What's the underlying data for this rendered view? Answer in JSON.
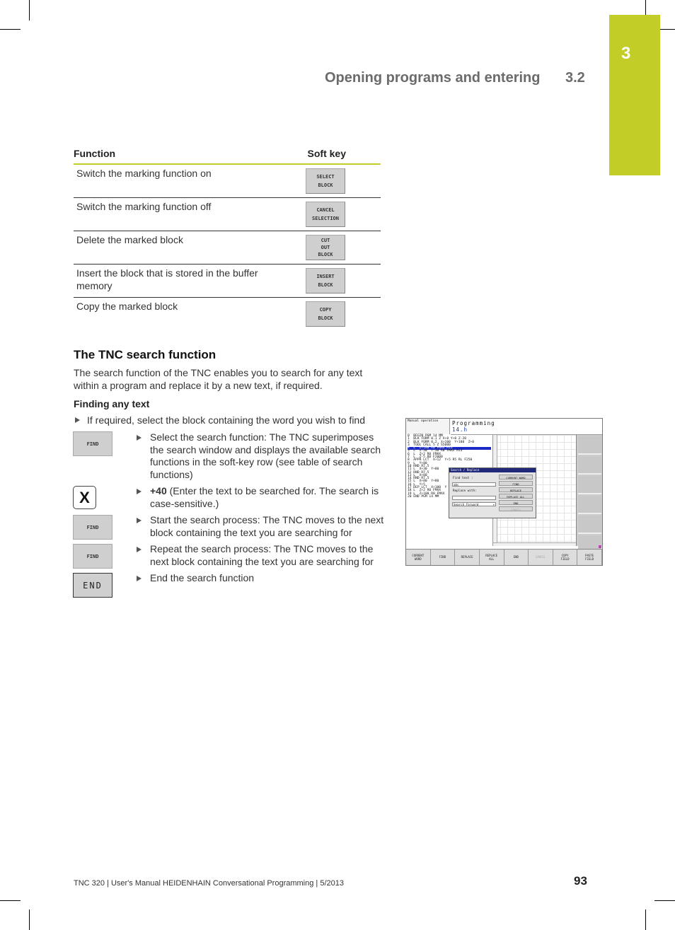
{
  "header": {
    "chapter_number": "3",
    "section_title": "Opening programs and entering",
    "section_number": "3.2",
    "accent_color": "#c3cd27"
  },
  "table": {
    "col_function": "Function",
    "col_softkey": "Soft key",
    "rows": [
      {
        "function": "Switch the marking function on",
        "softkey": [
          "SELECT",
          "BLOCK"
        ]
      },
      {
        "function": "Switch the marking function off",
        "softkey": [
          "CANCEL",
          "SELECTION"
        ]
      },
      {
        "function": "Delete the marked block",
        "softkey": [
          "CUT",
          "OUT",
          "BLOCK"
        ]
      },
      {
        "function": "Insert the block that is stored in the buffer memory",
        "softkey": [
          "INSERT",
          "BLOCK"
        ]
      },
      {
        "function": "Copy the marked block",
        "softkey": [
          "COPY",
          "BLOCK"
        ]
      }
    ]
  },
  "section": {
    "title": "The TNC search function",
    "intro": "The search function of the TNC enables you to search for any text within a program and replace it by a new text, if required.",
    "subtitle": "Finding any text",
    "first_bullet": "If required, select the block containing the word you wish to find",
    "steps": [
      {
        "key": "FIND",
        "key_type": "softkey",
        "bold": "",
        "text": "Select the search function: The TNC superimposes the search window and displays the available search functions in the soft-key row (see table of search functions)"
      },
      {
        "key": "X",
        "key_type": "x-key-icon",
        "bold": "+40",
        "text": " (Enter the text to be searched for. The search is case-sensitive.)"
      },
      {
        "key": "FIND",
        "key_type": "softkey",
        "bold": "",
        "text": "Start the search process: The TNC moves to the next block containing the text you are searching for"
      },
      {
        "key": "FIND",
        "key_type": "softkey",
        "bold": "",
        "text": "Repeat the search process: The TNC moves to the next block containing the text you are searching for"
      },
      {
        "key": "END",
        "key_type": "end-key",
        "bold": "",
        "text": "End the search function"
      }
    ]
  },
  "tnc_screen": {
    "mode": "Manual operation",
    "title": "Programming",
    "file": "14.h",
    "program_lines": [
      "0  BEGIN PGM 14 MM",
      "1  BLK FORM 0.1 Z X+0 Y+0 Z-20",
      "2  BLK FORM 0.2  X+100  Y+100  Z+0",
      "3  TOOL CALL 5 Z S5000",
      "4  L  Z+100 R0 FMAX M13",
      "5  L  X-30  Y-30 R0 FMAX M13",
      "6  L  Z+2 R0 FMAX",
      "7  L  Z-5 R0 F2000",
      "8  APPR LCT  X+12  Y+5 R5 RL F250",
      "9  L  Y+80",
      "10 RND R7.5",
      "11 L  X+30  Y+80",
      "12 RND R7.5",
      "13 L  X+80",
      "14 RND R7.5",
      "15 L  X+80  Y+80",
      "16 L  Y+5",
      "17 DEP LCT  X+100  Y",
      "18 L  Z+2 R0 FMAX",
      "19 L  Z+100 R0 FMAX",
      "20 END PGM 14 MM"
    ],
    "selected_line": 4,
    "dialog": {
      "title": "Search / Replace",
      "find_label": "Find text :",
      "find_value": "abc",
      "replace_label": "Replace with:",
      "replace_value": "",
      "direction": "Search forward",
      "buttons": [
        "CURRENT WORD",
        "FIND",
        "REPLACE",
        "REPLACE ALL",
        "END",
        "CANCEL"
      ],
      "disabled": [
        "CANCEL"
      ]
    },
    "softkeys": [
      [
        "CURRENT",
        "WORD"
      ],
      [
        "FIND"
      ],
      [
        "REPLACE"
      ],
      [
        "REPLACE",
        "ALL"
      ],
      [
        "END"
      ],
      [
        "CANCEL"
      ],
      [
        "COPY",
        "FIELD"
      ],
      [
        "PASTE",
        "FIELD"
      ]
    ],
    "disabled_softkeys": [
      "CANCEL"
    ]
  },
  "footer": {
    "text": "TNC 320 | User's Manual HEIDENHAIN Conversational Programming | 5/2013",
    "page_number": "93"
  }
}
